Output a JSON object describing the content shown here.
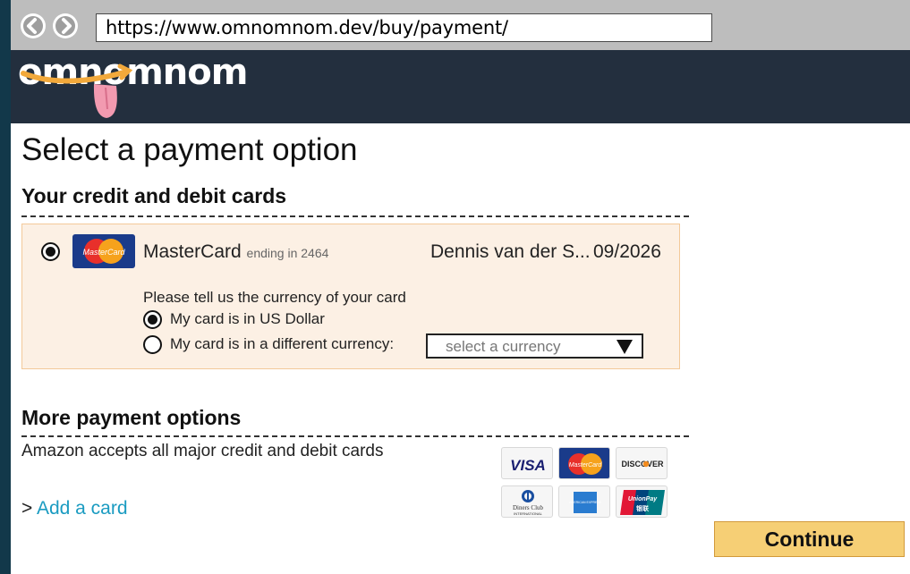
{
  "browser": {
    "url": "https://www.omnomnom.dev/buy/payment/",
    "back_icon": "back-arrow-icon",
    "forward_icon": "forward-arrow-icon"
  },
  "header": {
    "logo_text": "omnomnom"
  },
  "page": {
    "title": "Select a payment option"
  },
  "cards_section": {
    "heading": "Your credit and debit cards",
    "card": {
      "brand": "MasterCard",
      "ending_text": "ending in 2464",
      "holder": "Dennis van der S...",
      "expiry": "09/2026",
      "logo_text": "MasterCard",
      "selected": true
    },
    "currency_question": "Please tell us the currency of your card",
    "options": [
      {
        "label": "My card is in US Dollar",
        "selected": true
      },
      {
        "label": "My card is in a different currency:",
        "selected": false
      }
    ],
    "currency_select": {
      "placeholder": "select a currency"
    }
  },
  "more_section": {
    "heading": "More payment options",
    "accepts_text": "Amazon accepts all major credit and debit cards",
    "add_prefix": ">",
    "add_link": "Add a card",
    "logos": {
      "visa": "VISA",
      "mastercard": "MasterCard",
      "discover": "DISCOVER",
      "diners_line1": "Diners Club",
      "diners_line2": "INTERNATIONAL",
      "amex": "AMERICAN EXPRESS",
      "unionpay_line1": "UnionPay",
      "unionpay_line2": "银联"
    }
  },
  "actions": {
    "continue_label": "Continue"
  },
  "colors": {
    "accent_link": "#1a9bc1",
    "header_bg": "#232f3e",
    "button_bg": "#f6cf75",
    "panel_bg": "#fcf0e4"
  }
}
